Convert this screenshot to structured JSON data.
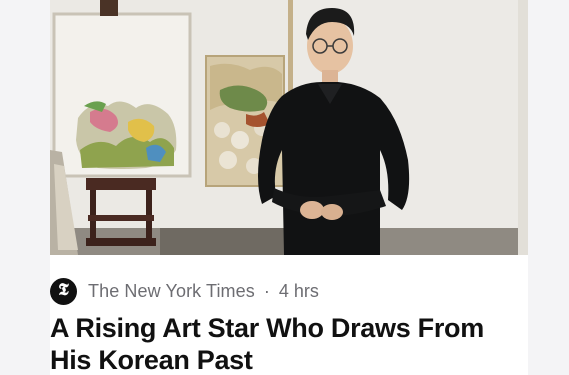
{
  "article": {
    "source": "The New York Times",
    "separator": "·",
    "time": "4 hrs",
    "headline": "A Rising Art Star Who Draws From His Korean Past",
    "logo_letter": "𝕿"
  },
  "icons": {
    "publisher_logo": "nyt-logo-icon"
  }
}
